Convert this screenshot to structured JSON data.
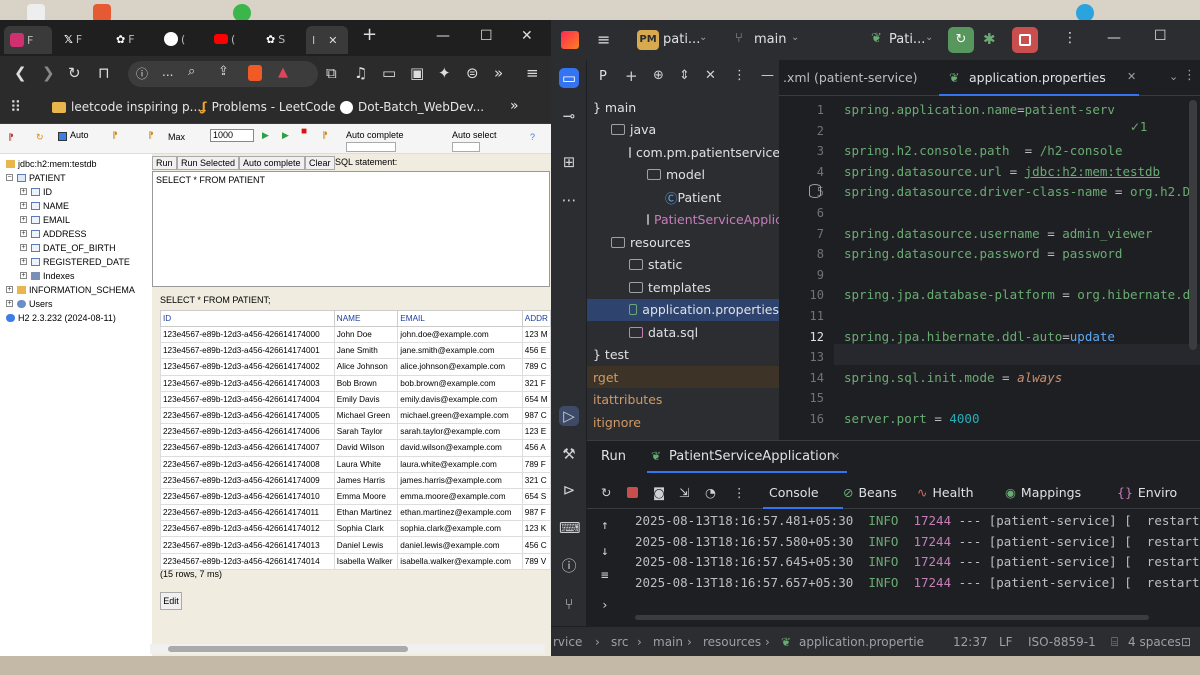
{
  "browser": {
    "tabs": [
      "F",
      "F",
      "F",
      "(",
      "(",
      "S",
      "I"
    ],
    "new_tab": "+",
    "window": {
      "minimize": "—",
      "maximize": "☐",
      "close": "✕"
    },
    "url": "...",
    "bookmarks": [
      "leetcode inspiring p...",
      "Problems - LeetCode",
      "Dot-Batch_WebDev..."
    ],
    "bookmarks_more": "»"
  },
  "h2": {
    "toolbar": {
      "auto_commit": "Auto",
      "max_label": "Max",
      "max_value": "1000",
      "auto_complete": "Auto complete",
      "auto_select": "Auto select"
    },
    "tree": {
      "connection": "jdbc:h2:mem:testdb",
      "table": "PATIENT",
      "columns": [
        "ID",
        "NAME",
        "EMAIL",
        "ADDRESS",
        "DATE_OF_BIRTH",
        "REGISTERED_DATE"
      ],
      "indexes": "Indexes",
      "schema": "INFORMATION_SCHEMA",
      "users": "Users",
      "version": "H2 2.3.232 (2024-08-11)"
    },
    "buttons": {
      "run": "Run",
      "run_selected": "Run Selected",
      "auto_complete": "Auto complete",
      "clear": "Clear",
      "sql_label": "SQL statement:"
    },
    "sql": "SELECT * FROM PATIENT",
    "result": {
      "echo": "SELECT * FROM PATIENT;",
      "headers": [
        "ID",
        "NAME",
        "EMAIL",
        "ADDR"
      ],
      "rows": [
        [
          "123e4567-e89b-12d3-a456-426614174000",
          "John Doe",
          "john.doe@example.com",
          "123 M"
        ],
        [
          "123e4567-e89b-12d3-a456-426614174001",
          "Jane Smith",
          "jane.smith@example.com",
          "456 E"
        ],
        [
          "123e4567-e89b-12d3-a456-426614174002",
          "Alice Johnson",
          "alice.johnson@example.com",
          "789 C"
        ],
        [
          "123e4567-e89b-12d3-a456-426614174003",
          "Bob Brown",
          "bob.brown@example.com",
          "321 F"
        ],
        [
          "123e4567-e89b-12d3-a456-426614174004",
          "Emily Davis",
          "emily.davis@example.com",
          "654 M"
        ],
        [
          "223e4567-e89b-12d3-a456-426614174005",
          "Michael Green",
          "michael.green@example.com",
          "987 C"
        ],
        [
          "223e4567-e89b-12d3-a456-426614174006",
          "Sarah Taylor",
          "sarah.taylor@example.com",
          "123 E"
        ],
        [
          "223e4567-e89b-12d3-a456-426614174007",
          "David Wilson",
          "david.wilson@example.com",
          "456 A"
        ],
        [
          "223e4567-e89b-12d3-a456-426614174008",
          "Laura White",
          "laura.white@example.com",
          "789 F"
        ],
        [
          "223e4567-e89b-12d3-a456-426614174009",
          "James Harris",
          "james.harris@example.com",
          "321 C"
        ],
        [
          "223e4567-e89b-12d3-a456-426614174010",
          "Emma Moore",
          "emma.moore@example.com",
          "654 S"
        ],
        [
          "223e4567-e89b-12d3-a456-426614174011",
          "Ethan Martinez",
          "ethan.martinez@example.com",
          "987 F"
        ],
        [
          "223e4567-e89b-12d3-a456-426614174012",
          "Sophia Clark",
          "sophia.clark@example.com",
          "123 K"
        ],
        [
          "223e4567-e89b-12d3-a456-426614174013",
          "Daniel Lewis",
          "daniel.lewis@example.com",
          "456 C"
        ],
        [
          "223e4567-e89b-12d3-a456-426614174014",
          "Isabella Walker",
          "isabella.walker@example.com",
          "789 V"
        ]
      ],
      "summary": "(15 rows, 7 ms)",
      "edit": "Edit"
    }
  },
  "ide": {
    "project_badge": "PM",
    "project_name": "pati...",
    "branch": "main",
    "run_config": "Pati...",
    "project_tool": "P",
    "tree": [
      {
        "label": "} main",
        "depth": 0
      },
      {
        "label": "java",
        "depth": 1
      },
      {
        "label": "com.pm.patientservice",
        "depth": 2
      },
      {
        "label": "model",
        "depth": 3
      },
      {
        "label": "Patient",
        "depth": 4
      },
      {
        "label": "PatientServiceApplicat",
        "depth": 3
      },
      {
        "label": "resources",
        "depth": 1
      },
      {
        "label": "static",
        "depth": 2
      },
      {
        "label": "templates",
        "depth": 2
      },
      {
        "label": "application.properties",
        "depth": 2
      },
      {
        "label": "data.sql",
        "depth": 2
      },
      {
        "label": "} test",
        "depth": 0
      },
      {
        "label": "rget",
        "depth": 0
      },
      {
        "label": "itattributes",
        "depth": 0
      },
      {
        "label": "itignore",
        "depth": 0
      }
    ],
    "tabs": [
      ".xml (patient-service)",
      "application.properties"
    ],
    "code_lines": [
      {
        "n": "1",
        "key": "spring.application.name",
        "op": "=",
        "val": "patient-serv"
      },
      {
        "n": "2",
        "key": "",
        "op": "",
        "val": ""
      },
      {
        "n": "3",
        "key": "spring.h2.console.path",
        "op": "  = ",
        "val": "/h2-console"
      },
      {
        "n": "4",
        "key": "spring.datasource.url",
        "op": " = ",
        "val": "jdbc:h2:mem:testdb"
      },
      {
        "n": "5",
        "key": "spring.datasource.driver-class-name",
        "op": " = ",
        "val": "org.h2.D"
      },
      {
        "n": "6",
        "key": "",
        "op": "",
        "val": ""
      },
      {
        "n": "7",
        "key": "spring.datasource.username",
        "op": " = ",
        "val": "admin_viewer"
      },
      {
        "n": "8",
        "key": "spring.datasource.password",
        "op": " = ",
        "val": "password"
      },
      {
        "n": "9",
        "key": "",
        "op": "",
        "val": ""
      },
      {
        "n": "10",
        "key": "spring.jpa.database-platform",
        "op": " = ",
        "val": "org.hibernate.d"
      },
      {
        "n": "11",
        "key": "",
        "op": "",
        "val": ""
      },
      {
        "n": "12",
        "key": "spring.jpa.hibernate.ddl-auto",
        "op": "=",
        "val": "update"
      },
      {
        "n": "13",
        "key": "",
        "op": "",
        "val": ""
      },
      {
        "n": "14",
        "key": "spring.sql.init.mode",
        "op": " = ",
        "val": "always"
      },
      {
        "n": "15",
        "key": "",
        "op": "",
        "val": ""
      },
      {
        "n": "16",
        "key": "server.port",
        "op": " = ",
        "val": "4000"
      }
    ],
    "inspections": "✓1",
    "run": {
      "title": "Run",
      "config": "PatientServiceApplication",
      "tabs": [
        "Console",
        "Beans",
        "Health",
        "Mappings",
        "Enviro"
      ],
      "log": [
        {
          "ts": "2025-08-13T18:16:57.481+05:30",
          "level": "INFO",
          "pid": "17244",
          "rest": " --- [patient-service] [  restart"
        },
        {
          "ts": "2025-08-13T18:16:57.580+05:30",
          "level": "INFO",
          "pid": "17244",
          "rest": " --- [patient-service] [  restart"
        },
        {
          "ts": "2025-08-13T18:16:57.645+05:30",
          "level": "INFO",
          "pid": "17244",
          "rest": " --- [patient-service] [  restart"
        },
        {
          "ts": "2025-08-13T18:16:57.657+05:30",
          "level": "INFO",
          "pid": "17244",
          "rest": " --- [patient-service] [  restart"
        }
      ]
    },
    "status": {
      "breadcrumb": [
        "rvice",
        "src",
        "main",
        "resources",
        "application.propertie"
      ],
      "position": "12:37",
      "line_sep": "LF",
      "encoding": "ISO-8859-1",
      "indent": "4 spaces"
    }
  }
}
